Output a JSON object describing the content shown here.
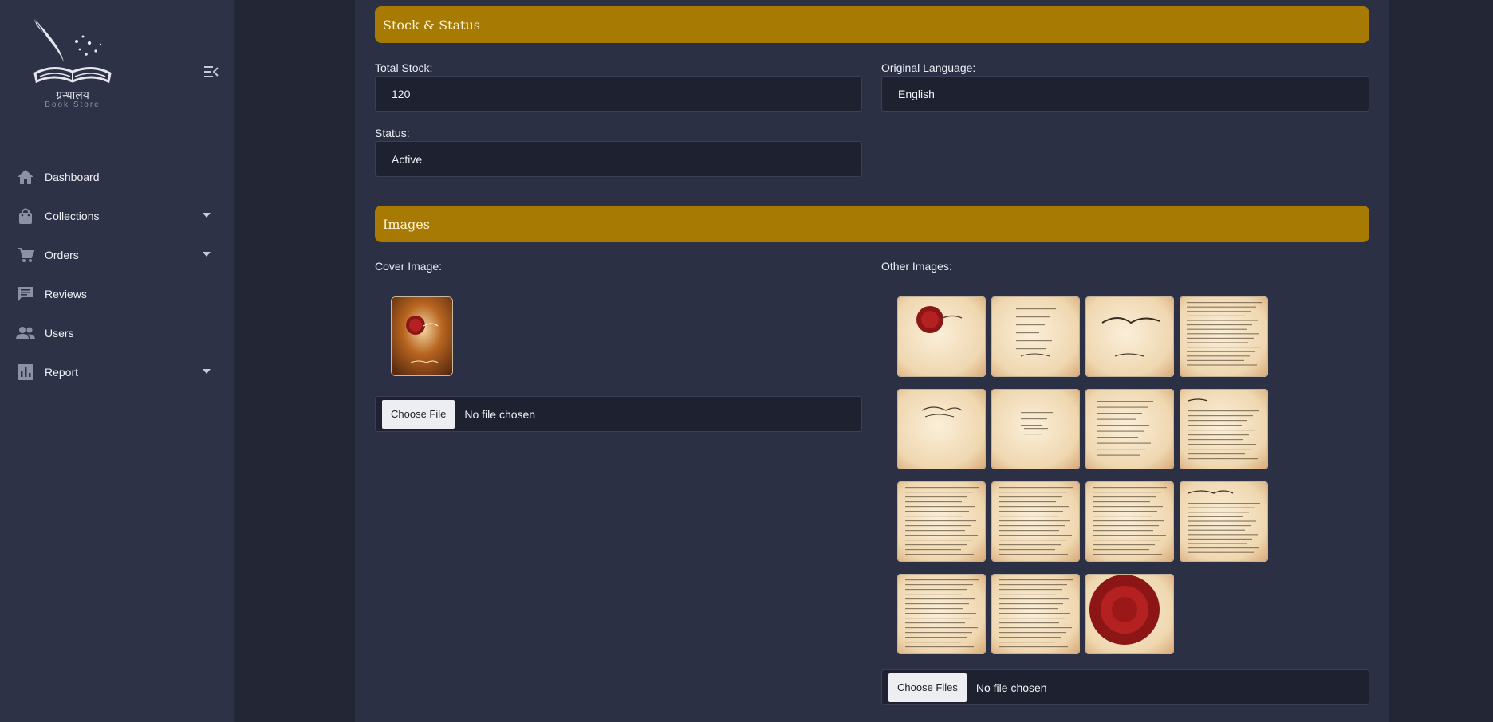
{
  "brand": {
    "name": "ग्रन्थालय",
    "subtitle": "Book Store"
  },
  "sidebar": {
    "items": [
      {
        "label": "Dashboard",
        "icon": "home-icon",
        "has_caret": false
      },
      {
        "label": "Collections",
        "icon": "bag-icon",
        "has_caret": true
      },
      {
        "label": "Orders",
        "icon": "cart-icon",
        "has_caret": true
      },
      {
        "label": "Reviews",
        "icon": "chat-icon",
        "has_caret": false
      },
      {
        "label": "Users",
        "icon": "users-icon",
        "has_caret": false
      },
      {
        "label": "Report",
        "icon": "bar-chart-icon",
        "has_caret": true
      }
    ]
  },
  "stock_section": {
    "title": "Stock & Status",
    "total_stock_label": "Total Stock:",
    "total_stock_value": "120",
    "language_label": "Original Language:",
    "language_value": "English",
    "status_label": "Status:",
    "status_value": "Active"
  },
  "images_section": {
    "title": "Images",
    "cover_label": "Cover Image:",
    "cover_button": "Choose File",
    "cover_file_text": "No file chosen",
    "other_label": "Other Images:",
    "other_button": "Choose Files",
    "other_file_text": "No file chosen",
    "other_images": [
      "seal-cover-page",
      "title-credits-page",
      "the-secret-title-page",
      "dense-text-page",
      "signature-page",
      "dedication-page",
      "contents-page",
      "foreword-page",
      "text-page",
      "text-page",
      "text-page",
      "chapter-start-page",
      "text-page",
      "text-page",
      "red-seal-page"
    ]
  },
  "colors": {
    "sidebar_bg": "#2e3247",
    "page_bg": "#232634",
    "content_bg": "#2c3045",
    "section_accent": "#a67a03",
    "input_bg": "#1e2130"
  }
}
